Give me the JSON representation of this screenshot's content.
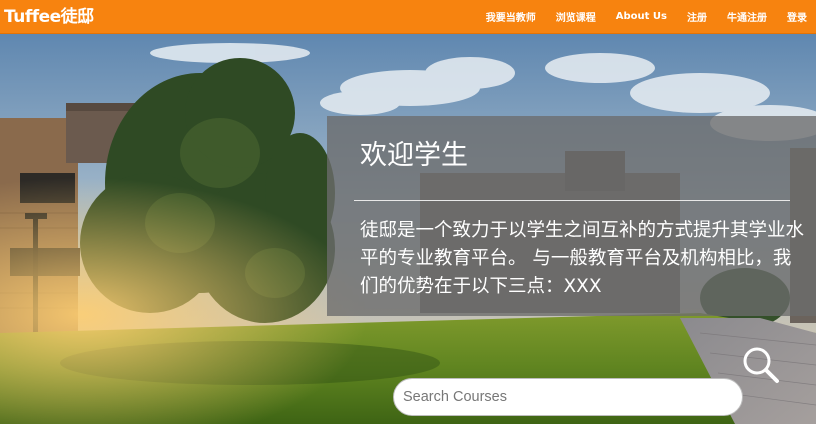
{
  "navbar": {
    "logo": "Tuffee徒邸",
    "items": [
      {
        "label": "我要当教师"
      },
      {
        "label": "浏览课程"
      },
      {
        "label": "About Us"
      },
      {
        "label": "注册"
      },
      {
        "label": "牛通注册"
      },
      {
        "label": "登录"
      }
    ]
  },
  "welcome": {
    "title": "欢迎学生",
    "description": "徒邸是一个致力于以学生之间互补的方式提升其学业水平的专业教育平台。 与一般教育平台及机构相比，我们的优势在于以下三点：XXX"
  },
  "search": {
    "placeholder": "Search Courses",
    "value": ""
  },
  "colors": {
    "brand": "#f7830f",
    "panel": "#6c6c6c",
    "text": "#ffffff"
  },
  "icons": {
    "search": "search-icon"
  }
}
